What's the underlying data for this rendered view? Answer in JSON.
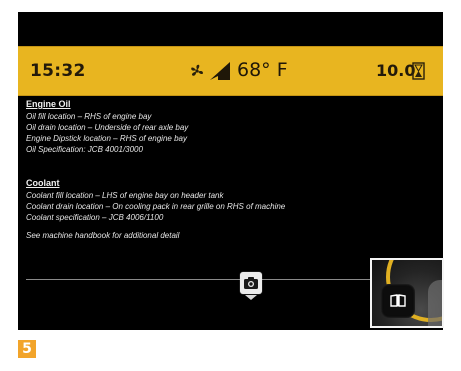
{
  "status_bar": {
    "time": "15:32",
    "temperature": "68° F",
    "hours": "10.0",
    "icons": [
      "fan-icon",
      "level-icon",
      "hourglass-icon"
    ],
    "background_color": "#e8b520"
  },
  "engine_oil": {
    "title": "Engine Oil",
    "lines": [
      "Oil fill location – RHS of engine bay",
      "Oil drain location – Underside of rear axle bay",
      "Engine Dipstick location – RHS of engine bay",
      "Oil Specification: JCB 4001/3000"
    ]
  },
  "coolant": {
    "title": "Coolant",
    "lines": [
      "Coolant fill location – LHS of engine bay on header tank",
      "Coolant drain location – On cooling pack in rear grille on RHS of machine",
      "Coolant specification – JCB 4006/1100"
    ]
  },
  "footer_note": "See machine handbook for additional detail",
  "controls": {
    "camera_icon": "camera-icon",
    "arrow_icon": "chevron-down-icon",
    "inset_icon": "book-icon"
  },
  "figure_label": "5",
  "figure_label_color": "#f2a42a"
}
